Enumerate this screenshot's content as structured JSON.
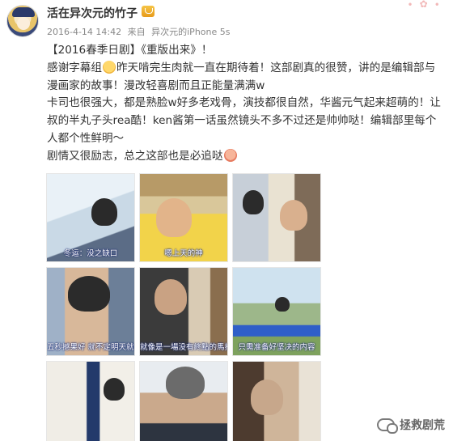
{
  "user": {
    "name": "活在异次元的竹子",
    "avatar_icon": "anime-avatar",
    "badge_icon": "crown-badge-icon"
  },
  "meta": {
    "time": "2016-4-14 14:42",
    "via": "来自",
    "source": "异次元的iPhone 5s"
  },
  "post": {
    "line1": "【2016春季日剧】《重版出来》！",
    "line2a": "感谢字幕组",
    "line2b": "昨天啃完生肉就一直在期待着！这部剧真的很赞，讲的是编辑部与",
    "line3": "漫画家的故事！漫改轻喜剧而且正能量满满w",
    "line4": "卡司也很强大，都是熟脸w好多老戏骨，演技都很自然，华酱元气起来超萌的！让",
    "line5": "叔的半丸子头rea酷！ken酱第一话虽然镜头不多不过还是帅帅哒！编辑部里每个",
    "line6": "人都个性鲜明～",
    "line7": "剧情又很励志，总之这部也是必追哒"
  },
  "images": [
    {
      "caption": "冬运：没之缺口"
    },
    {
      "caption": "嗯上天的神"
    },
    {
      "caption": ""
    },
    {
      "caption": "五秒撼果好 就不定明天就能…"
    },
    {
      "caption": "就像是一場没有終點的馬拉松"
    },
    {
      "caption": "只需准备好坚决的内容"
    },
    {
      "caption": ""
    },
    {
      "caption": ""
    },
    {
      "caption": ""
    }
  ],
  "watermark": {
    "text": "拯救剧荒",
    "icon": "wechat-icon"
  }
}
